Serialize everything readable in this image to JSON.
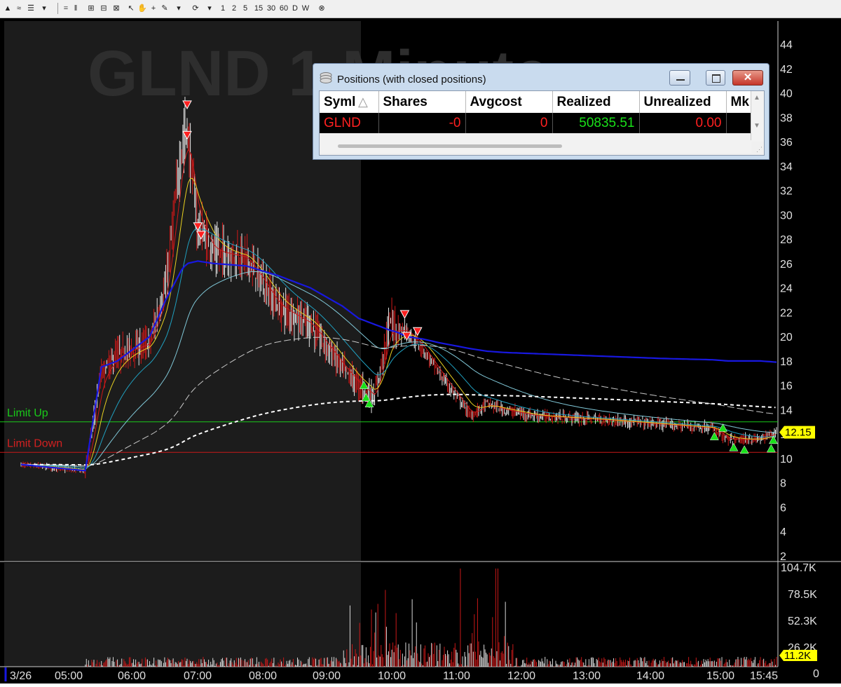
{
  "toolbar": {
    "items": [
      "1",
      "2",
      "5",
      "15",
      "30",
      "60",
      "D",
      "W"
    ]
  },
  "chart": {
    "watermark": "GLND  1 Minute",
    "price_axis_labels": [
      "44",
      "42",
      "40",
      "38",
      "36",
      "34",
      "32",
      "30",
      "28",
      "26",
      "24",
      "22",
      "20",
      "18",
      "16",
      "14",
      "12",
      "10",
      "8",
      "6",
      "4",
      "2"
    ],
    "volume_axis_labels": [
      "104.7K",
      "78.5K",
      "52.3K",
      "26.2K",
      "0"
    ],
    "time_labels": [
      "3/26",
      "05:00",
      "06:00",
      "07:00",
      "08:00",
      "09:00",
      "10:00",
      "11:00",
      "12:00",
      "13:00",
      "14:00",
      "15:00",
      "15:45"
    ],
    "limit_up_label": "Limit Up",
    "limit_down_label": "Limit Down",
    "last_price_badge": "12.15",
    "last_volume_badge": "11.2K",
    "colors": {
      "limit_up": "#19c919",
      "limit_down": "#c81818",
      "premarket_bg": "#1c1c1c",
      "vwap": "#1818e0",
      "badge": "#ffff00"
    }
  },
  "chart_data": {
    "type": "line",
    "title": "GLND 1 Minute",
    "y_range": [
      2,
      45
    ],
    "limit_up": 13.0,
    "limit_down": 10.5,
    "last_price": 12.15,
    "x_time": [
      "04:00",
      "05:00",
      "05:15",
      "05:30",
      "06:00",
      "06:15",
      "06:30",
      "06:35",
      "06:45",
      "07:00",
      "07:30",
      "08:00",
      "08:30",
      "09:00",
      "09:15",
      "09:30",
      "09:45",
      "09:50",
      "10:00",
      "10:15",
      "10:30",
      "11:00",
      "11:15",
      "11:30",
      "12:00",
      "13:00",
      "14:00",
      "14:45",
      "15:00",
      "15:30",
      "15:45"
    ],
    "series": [
      {
        "name": "Price",
        "values": [
          9.5,
          9.0,
          17.0,
          18.5,
          19.5,
          24.0,
          35.5,
          37.0,
          29.0,
          27.0,
          26.5,
          22.5,
          21.0,
          17.5,
          16.0,
          15.0,
          21.5,
          20.5,
          20.5,
          19.0,
          17.0,
          13.5,
          14.5,
          14.0,
          13.5,
          13.2,
          12.8,
          12.5,
          11.5,
          11.6,
          12.15
        ]
      },
      {
        "name": "VWAP",
        "values": [
          9.5,
          9.0,
          17.5,
          18.0,
          20.0,
          23.0,
          25.5,
          26.0,
          26.2,
          26.0,
          25.8,
          25.0,
          24.0,
          22.5,
          21.5,
          21.0,
          20.5,
          20.4,
          20.0,
          19.8,
          19.5,
          19.0,
          18.8,
          18.7,
          18.6,
          18.4,
          18.2,
          18.1,
          18.0,
          18.0,
          17.9
        ]
      }
    ],
    "volume": {
      "max_label": "104.7K",
      "last": "11.2K"
    },
    "markers": {
      "sell": [
        [
          "06:35",
          39.0
        ],
        [
          "06:35",
          36.5
        ],
        [
          "06:45",
          29.0
        ],
        [
          "06:48",
          28.3
        ],
        [
          "09:58",
          21.8
        ],
        [
          "10:00",
          20.0
        ],
        [
          "10:10",
          20.4
        ]
      ],
      "buy": [
        [
          "09:20",
          16.0
        ],
        [
          "09:22",
          15.0
        ],
        [
          "09:25",
          14.5
        ],
        [
          "14:47",
          11.8
        ],
        [
          "14:55",
          12.5
        ],
        [
          "15:05",
          10.9
        ],
        [
          "15:15",
          10.7
        ],
        [
          "15:40",
          10.8
        ],
        [
          "15:42",
          11.5
        ]
      ]
    }
  },
  "positions": {
    "title": "Positions (with closed positions)",
    "columns": [
      "Syml",
      "Shares",
      "Avgcost",
      "Realized",
      "Unrealized",
      "Mk"
    ],
    "rows": [
      {
        "symbol": "GLND",
        "shares": "-0",
        "avgcost": "0",
        "realized": "50835.51",
        "unrealized": "0.00"
      }
    ]
  }
}
